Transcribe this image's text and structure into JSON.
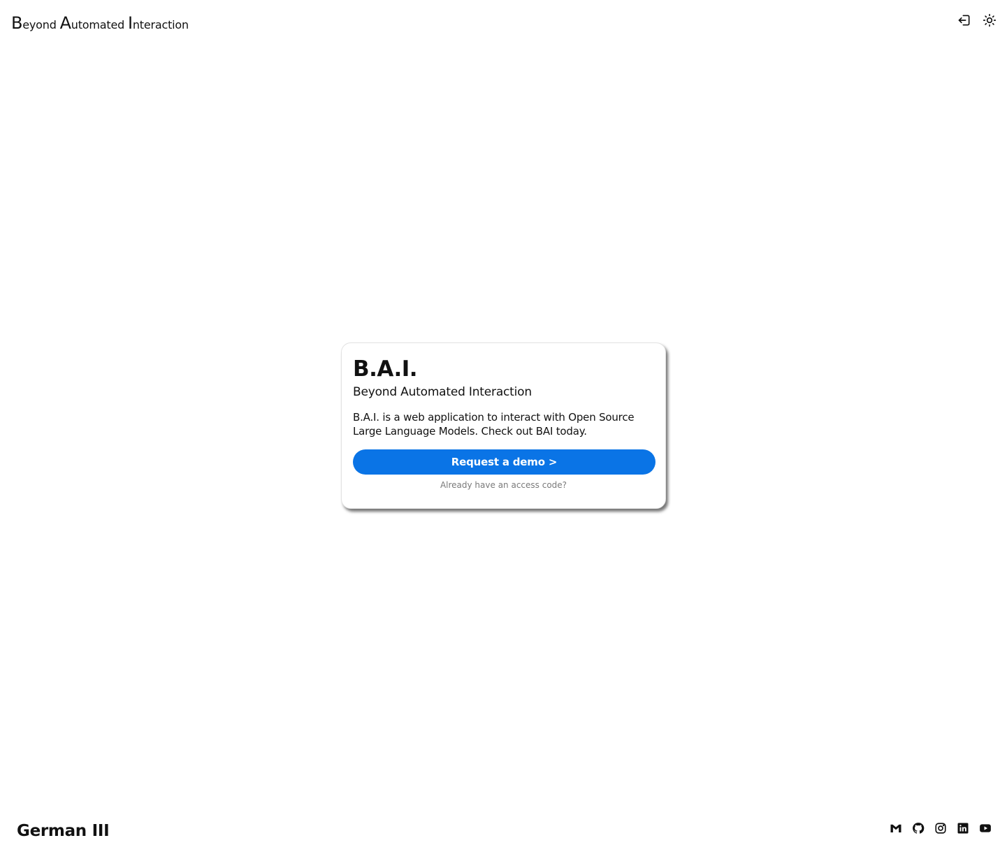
{
  "header": {
    "brand": [
      {
        "cap": "B",
        "rest": "eyond "
      },
      {
        "cap": "A",
        "rest": "utomated "
      },
      {
        "cap": "I",
        "rest": "nteraction"
      }
    ],
    "actions": [
      {
        "icon": "login-icon"
      },
      {
        "icon": "sun-icon"
      }
    ]
  },
  "card": {
    "title": "B.A.I.",
    "subtitle": "Beyond Automated Interaction",
    "description": "B.A.I. is a web application to interact with Open Source Large Language Models. Check out BAI today.",
    "button_label": "Request a demo >",
    "access_link": "Already have an access code?",
    "accent_color": "#0a74e6"
  },
  "footer": {
    "left_text": "German III",
    "social_icons": [
      "gmail-icon",
      "github-icon",
      "instagram-icon",
      "linkedin-icon",
      "youtube-icon"
    ]
  }
}
